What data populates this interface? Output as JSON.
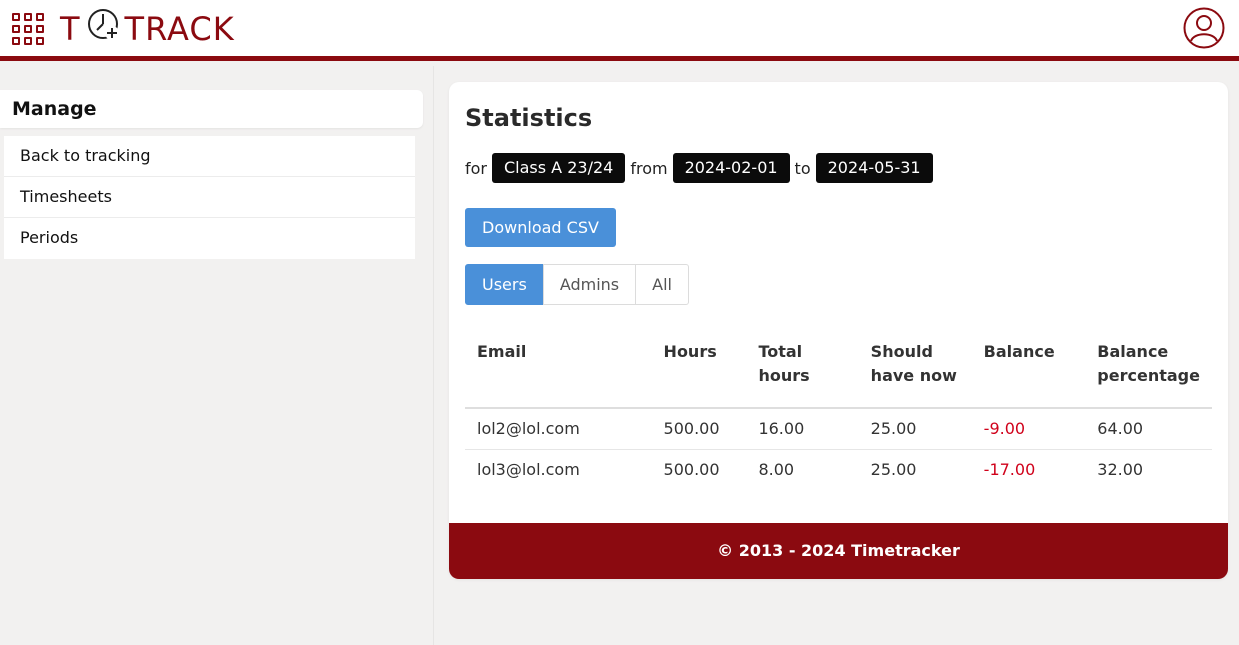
{
  "header": {
    "logo_text_left": "T",
    "logo_text_right": "TRACK",
    "apps_icon": "grid-icon",
    "user_icon": "user-avatar-icon"
  },
  "sidebar": {
    "title": "Manage",
    "items": [
      {
        "label": "Back to tracking"
      },
      {
        "label": "Timesheets"
      },
      {
        "label": "Periods"
      }
    ]
  },
  "main": {
    "title": "Statistics",
    "filters": {
      "for_label": "for",
      "class_value": "Class A 23/24",
      "from_label": "from",
      "from_value": "2024-02-01",
      "to_label": "to",
      "to_value": "2024-05-31"
    },
    "download_label": "Download CSV",
    "segments": [
      {
        "label": "Users",
        "active": true
      },
      {
        "label": "Admins",
        "active": false
      },
      {
        "label": "All",
        "active": false
      }
    ],
    "table": {
      "columns": [
        "Email",
        "Hours",
        "Total hours",
        "Should have now",
        "Balance",
        "Balance percentage"
      ],
      "rows": [
        {
          "email": "lol2@lol.com",
          "hours": "500.00",
          "total_hours": "16.00",
          "should_have_now": "25.00",
          "balance": "-9.00",
          "balance_percentage": "64.00"
        },
        {
          "email": "lol3@lol.com",
          "hours": "500.00",
          "total_hours": "8.00",
          "should_have_now": "25.00",
          "balance": "-17.00",
          "balance_percentage": "32.00"
        }
      ]
    }
  },
  "footer": {
    "text": "© 2013 - 2024 Timetracker"
  },
  "colors": {
    "brand": "#8b0a10",
    "accent": "#4a90d9",
    "negative": "#d0021b",
    "chip": "#0b0b0b"
  }
}
